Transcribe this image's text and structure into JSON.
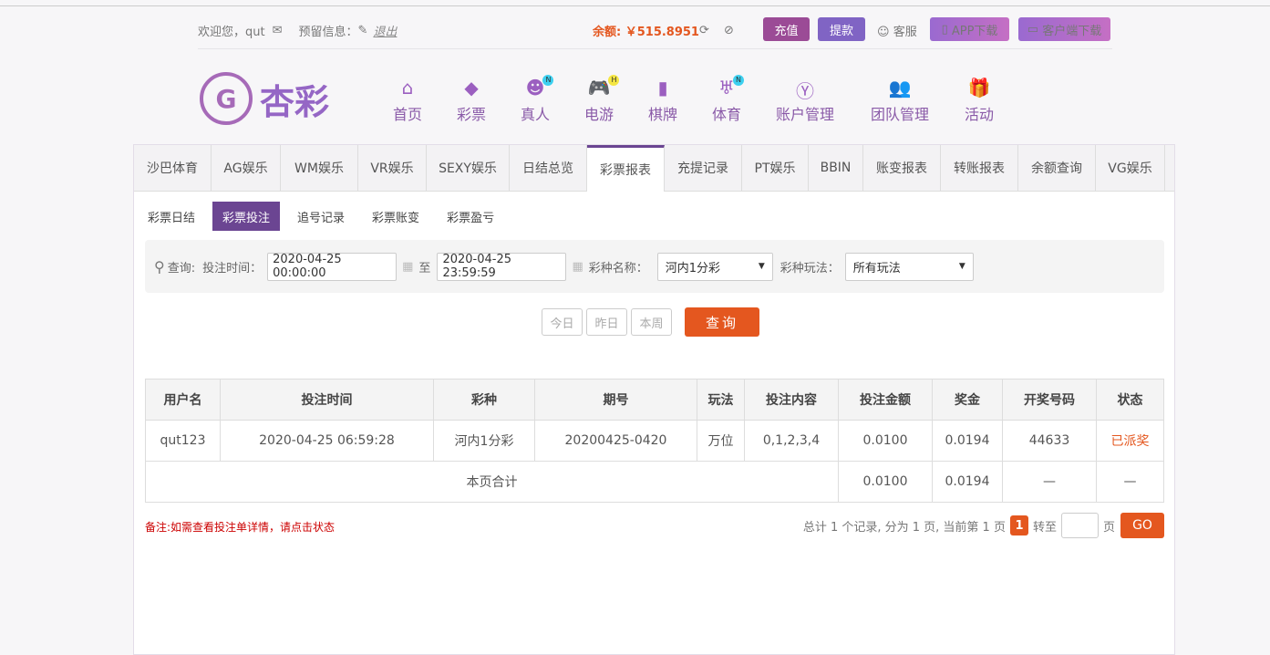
{
  "topbar": {
    "welcome": "欢迎您，qut",
    "reserved": "预留信息：",
    "logout": "退出",
    "balance": "余额: ￥515.8951",
    "recharge": "充值",
    "withdraw": "提款",
    "service": "客服",
    "app_download": "APP下载",
    "client_download": "客户端下载"
  },
  "logo": {
    "text": "杏彩"
  },
  "nav": [
    {
      "label": "首页",
      "icon": "home-icon"
    },
    {
      "label": "彩票",
      "icon": "ticket-icon"
    },
    {
      "label": "真人",
      "icon": "live-dealer-icon",
      "badge": "N"
    },
    {
      "label": "电游",
      "icon": "gamepad-icon",
      "badge": "H"
    },
    {
      "label": "棋牌",
      "icon": "cards-icon"
    },
    {
      "label": "体育",
      "icon": "trophy-icon",
      "badge": "N"
    },
    {
      "label": "账户管理",
      "icon": "yen-icon"
    },
    {
      "label": "团队管理",
      "icon": "team-icon"
    },
    {
      "label": "活动",
      "icon": "gift-icon"
    }
  ],
  "tabs": [
    "沙巴体育",
    "AG娱乐",
    "WM娱乐",
    "VR娱乐",
    "SEXY娱乐",
    "日结总览",
    "彩票报表",
    "充提记录",
    "PT娱乐",
    "BBIN",
    "账变报表",
    "转账报表",
    "余额查询",
    "VG娱乐"
  ],
  "active_tab": "彩票报表",
  "subtabs": [
    "彩票日结",
    "彩票投注",
    "追号记录",
    "彩票账变",
    "彩票盈亏"
  ],
  "active_subtab": "彩票投注",
  "filter": {
    "query_label": "查询:",
    "time_label": "投注时间：",
    "start": "2020-04-25 00:00:00",
    "to": "至",
    "end": "2020-04-25 23:59:59",
    "lottery_label": "彩种名称：",
    "lottery": "河内1分彩",
    "play_label": "彩种玩法：",
    "play": "所有玩法"
  },
  "quick": {
    "today": "今日",
    "yesterday": "昨日",
    "week": "本周",
    "search": "查询"
  },
  "table": {
    "headers": [
      "用户名",
      "投注时间",
      "彩种",
      "期号",
      "玩法",
      "投注内容",
      "投注金额",
      "奖金",
      "开奖号码",
      "状态"
    ],
    "rows": [
      [
        "qut123",
        "2020-04-25 06:59:28",
        "河内1分彩",
        "20200425-0420",
        "万位",
        "0,1,2,3,4",
        "0.0100",
        "0.0194",
        "44633",
        "已派奖"
      ]
    ],
    "total": {
      "label": "本页合计",
      "amount": "0.0100",
      "bonus": "0.0194",
      "numbers": "—",
      "status": "—"
    }
  },
  "note": "备注:如需查看投注单详情，请点击状态",
  "pager": {
    "summary": "总计 1 个记录, 分为 1 页, 当前第 1 页",
    "current": "1",
    "goto": "转至",
    "page": "页",
    "go": "GO"
  },
  "colors": {
    "accent": "#e4571f",
    "purple": "#6b4592",
    "status": "#e4571f"
  }
}
